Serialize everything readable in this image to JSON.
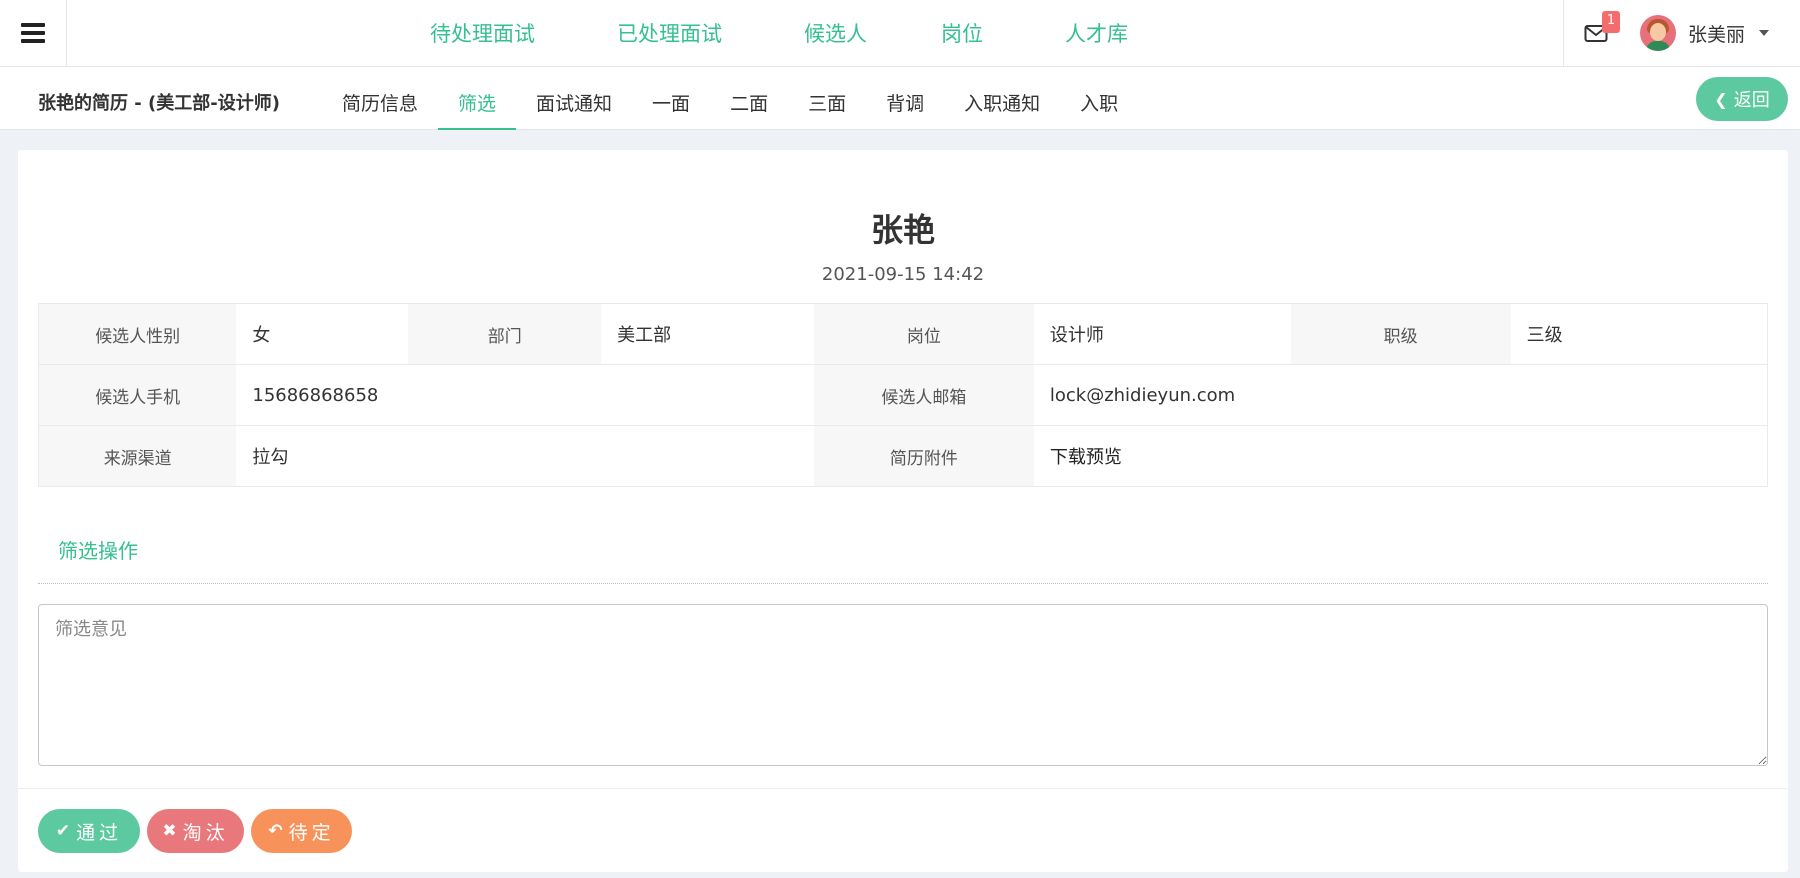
{
  "topnav": {
    "items": [
      "待处理面试",
      "已处理面试",
      "候选人",
      "岗位",
      "人才库"
    ],
    "mail_badge": "1",
    "username": "张美丽"
  },
  "subnav": {
    "resume_title": "张艳的简历 - (美工部-设计师)",
    "tabs": [
      "简历信息",
      "筛选",
      "面试通知",
      "一面",
      "二面",
      "三面",
      "背调",
      "入职通知",
      "入职"
    ],
    "active_tab": "筛选",
    "back_label": "返回"
  },
  "candidate": {
    "name": "张艳",
    "datetime": "2021-09-15 14:42"
  },
  "info": {
    "gender_label": "候选人性别",
    "gender": "女",
    "dept_label": "部门",
    "dept": "美工部",
    "post_label": "岗位",
    "post": "设计师",
    "level_label": "职级",
    "level": "三级",
    "phone_label": "候选人手机",
    "phone": "15686868658",
    "email_label": "候选人邮箱",
    "email": "lock@zhidieyun.com",
    "source_label": "来源渠道",
    "source": "拉勾",
    "attach_label": "简历附件",
    "attach": "下载预览"
  },
  "screening": {
    "section_title": "筛选操作",
    "opinion_placeholder": "筛选意见",
    "pass_label": "通过",
    "reject_label": "淘汰",
    "pending_label": "待定"
  },
  "colors": {
    "accent": "#36c08f",
    "button_green": "#5cc9a1",
    "button_red": "#e8787b",
    "button_orange": "#f7935a",
    "badge": "#f56c6c"
  },
  "icons": {
    "menu": "hamburger-icon",
    "mail": "envelope-icon",
    "back": "chevron-left-icon",
    "pass": "check-icon",
    "reject": "x-icon",
    "pending": "reply-icon"
  }
}
